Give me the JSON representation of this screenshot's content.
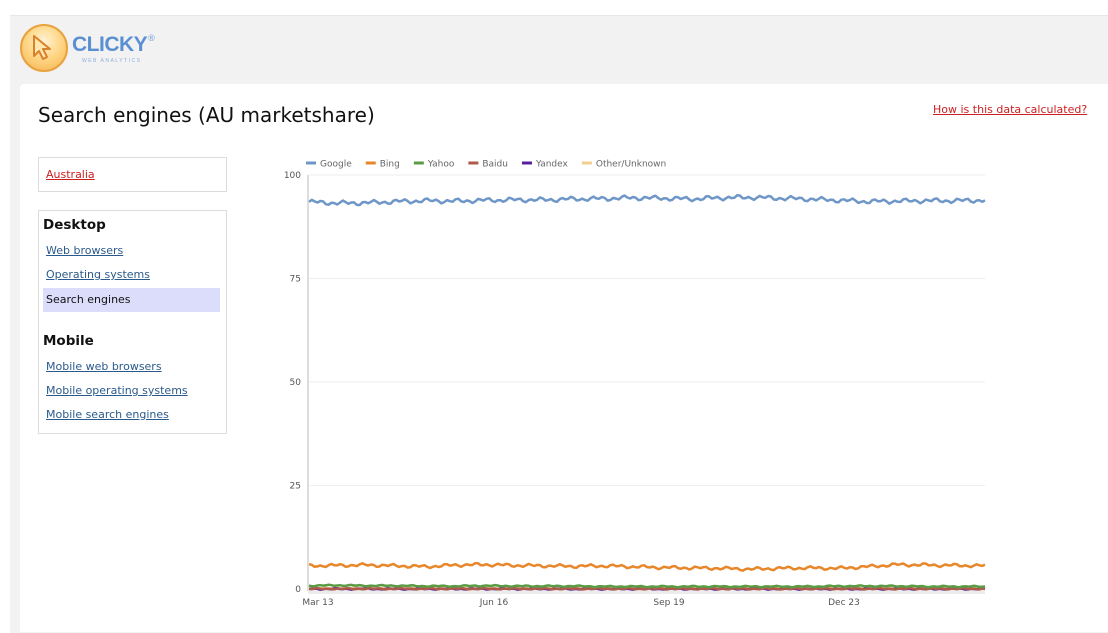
{
  "app": {
    "logo_text": "CLICKY",
    "logo_subtext": "WEB ANALYTICS",
    "logo_reg": "®"
  },
  "header": {
    "title": "Search engines (AU marketshare)",
    "help_link": "How is this data calculated?"
  },
  "sidebar": {
    "country": "Australia",
    "sections": [
      {
        "heading": "Desktop",
        "items": [
          {
            "label": "Web browsers",
            "active": false
          },
          {
            "label": "Operating systems",
            "active": false
          },
          {
            "label": "Search engines",
            "active": true
          }
        ]
      },
      {
        "heading": "Mobile",
        "items": [
          {
            "label": "Mobile web browsers",
            "active": false
          },
          {
            "label": "Mobile operating systems",
            "active": false
          },
          {
            "label": "Mobile search engines",
            "active": false
          }
        ]
      }
    ]
  },
  "chart_data": {
    "type": "line",
    "title": "",
    "xlabel": "",
    "ylabel": "",
    "ylim": [
      0,
      100
    ],
    "yticks": [
      0,
      25,
      50,
      75,
      100
    ],
    "xticks": [
      "Mar 13",
      "Jun 16",
      "Sep 19",
      "Dec 23"
    ],
    "x_start": "Mar 13",
    "grid": true,
    "legend_position": "top-left",
    "series": [
      {
        "name": "Google",
        "color": "#6e97c8",
        "values": [
          93.5,
          93.2,
          93.3,
          93.6,
          93.8,
          93.7,
          93.9,
          94.0,
          94.0,
          94.2,
          94.3,
          94.5,
          94.4,
          94.2,
          94.5,
          94.6,
          94.4,
          94.2,
          93.9,
          93.6,
          93.7,
          93.8,
          93.8,
          93.9
        ]
      },
      {
        "name": "Bing",
        "color": "#e8862a",
        "values": [
          5.6,
          5.7,
          5.8,
          5.6,
          5.4,
          5.8,
          5.9,
          5.7,
          5.6,
          5.5,
          5.6,
          5.4,
          5.2,
          5.1,
          5.0,
          4.8,
          5.0,
          5.1,
          5.0,
          5.4,
          5.9,
          5.8,
          5.7,
          5.6
        ]
      },
      {
        "name": "Yahoo",
        "color": "#5a9c46",
        "values": [
          0.8,
          0.9,
          0.8,
          0.8,
          0.7,
          0.7,
          0.8,
          0.7,
          0.7,
          0.7,
          0.6,
          0.6,
          0.6,
          0.6,
          0.6,
          0.6,
          0.6,
          0.6,
          0.7,
          0.7,
          0.7,
          0.6,
          0.6,
          0.6
        ]
      },
      {
        "name": "Baidu",
        "color": "#b05a4c",
        "values": [
          0.05,
          0.05,
          0.05,
          0.05,
          0.05,
          0.05,
          0.05,
          0.05,
          0.05,
          0.05,
          0.05,
          0.05,
          0.05,
          0.05,
          0.05,
          0.05,
          0.05,
          0.05,
          0.05,
          0.05,
          0.05,
          0.05,
          0.05,
          0.05
        ]
      },
      {
        "name": "Yandex",
        "color": "#5b1c9c",
        "values": [
          0.02,
          0.02,
          0.02,
          0.02,
          0.02,
          0.02,
          0.02,
          0.02,
          0.02,
          0.02,
          0.02,
          0.02,
          0.02,
          0.02,
          0.02,
          0.02,
          0.02,
          0.02,
          0.02,
          0.02,
          0.02,
          0.02,
          0.02,
          0.02
        ]
      },
      {
        "name": "Other/Unknown",
        "color": "#f2cf8c",
        "values": [
          0.2,
          0.2,
          0.2,
          0.2,
          0.2,
          0.2,
          0.2,
          0.2,
          0.2,
          0.2,
          0.2,
          0.2,
          0.2,
          0.2,
          0.2,
          0.2,
          0.2,
          0.2,
          0.2,
          0.2,
          0.2,
          0.2,
          0.2,
          0.2
        ]
      }
    ]
  }
}
